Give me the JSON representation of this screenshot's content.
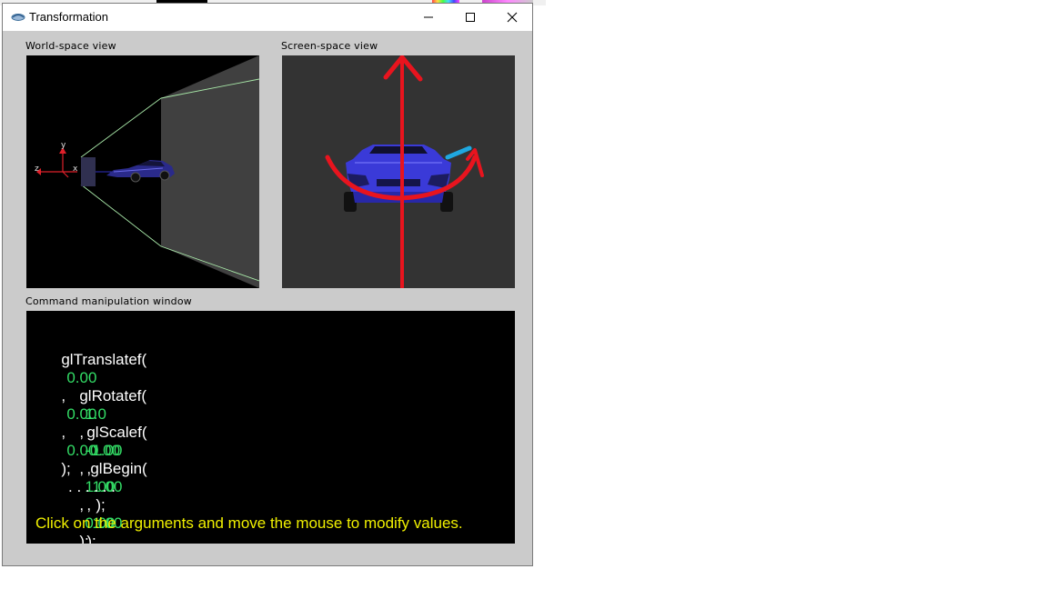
{
  "window": {
    "title": "Transformation",
    "controls": {
      "minimize": "minimize",
      "maximize": "maximize",
      "close": "close"
    }
  },
  "panels": {
    "world_label": "World-space view",
    "screen_label": "Screen-space view",
    "command_label": "Command manipulation window"
  },
  "world_axes": {
    "y": "y",
    "z": "z",
    "x": "x"
  },
  "commands": {
    "translate": {
      "name": "glTranslatef(",
      "args": [
        "0.00",
        "0.00",
        "0.00"
      ],
      "sep": ",",
      "end": ");"
    },
    "rotate": {
      "name": "glRotatef(",
      "args": [
        "1.0",
        "-0.00",
        "1.00",
        "0.00"
      ],
      "sep": ",",
      "end": ");"
    },
    "scale": {
      "name": "glScalef(",
      "args": [
        "1.00",
        "1.00",
        "1.00"
      ],
      "sep": ",",
      "end": ");"
    },
    "begin": {
      "name": "glBegin(",
      "args_text": ". . .",
      "end": ");"
    },
    "ellipsis": ". . .",
    "hint": "Click on the arguments and move the mouse to modify values."
  },
  "colors": {
    "arg_green": "#33dd66",
    "hint_yellow": "#f0f000",
    "annotation_red": "#e8141e",
    "annotation_cyan": "#1fa8e0",
    "car_blue": "#3a3ae0"
  }
}
